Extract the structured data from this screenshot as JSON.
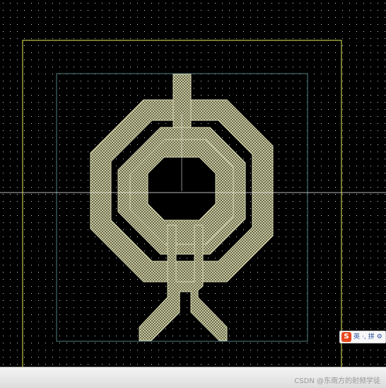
{
  "canvas": {
    "background": "#000000",
    "grid_color": "#d8d8d8",
    "boundary_color": "#e8f05a",
    "inner_boundary_color": "#5a8a8a",
    "crosshair_color": "#e6e6e6",
    "metal_color": "#b8b890"
  },
  "ime": {
    "logo": "S",
    "mode_label": "英",
    "punct_label": "·,",
    "pinyin_label": "拼",
    "settings_icon": "gear-icon"
  },
  "watermark": {
    "text": "CSDN @东南方的射频学徒"
  }
}
